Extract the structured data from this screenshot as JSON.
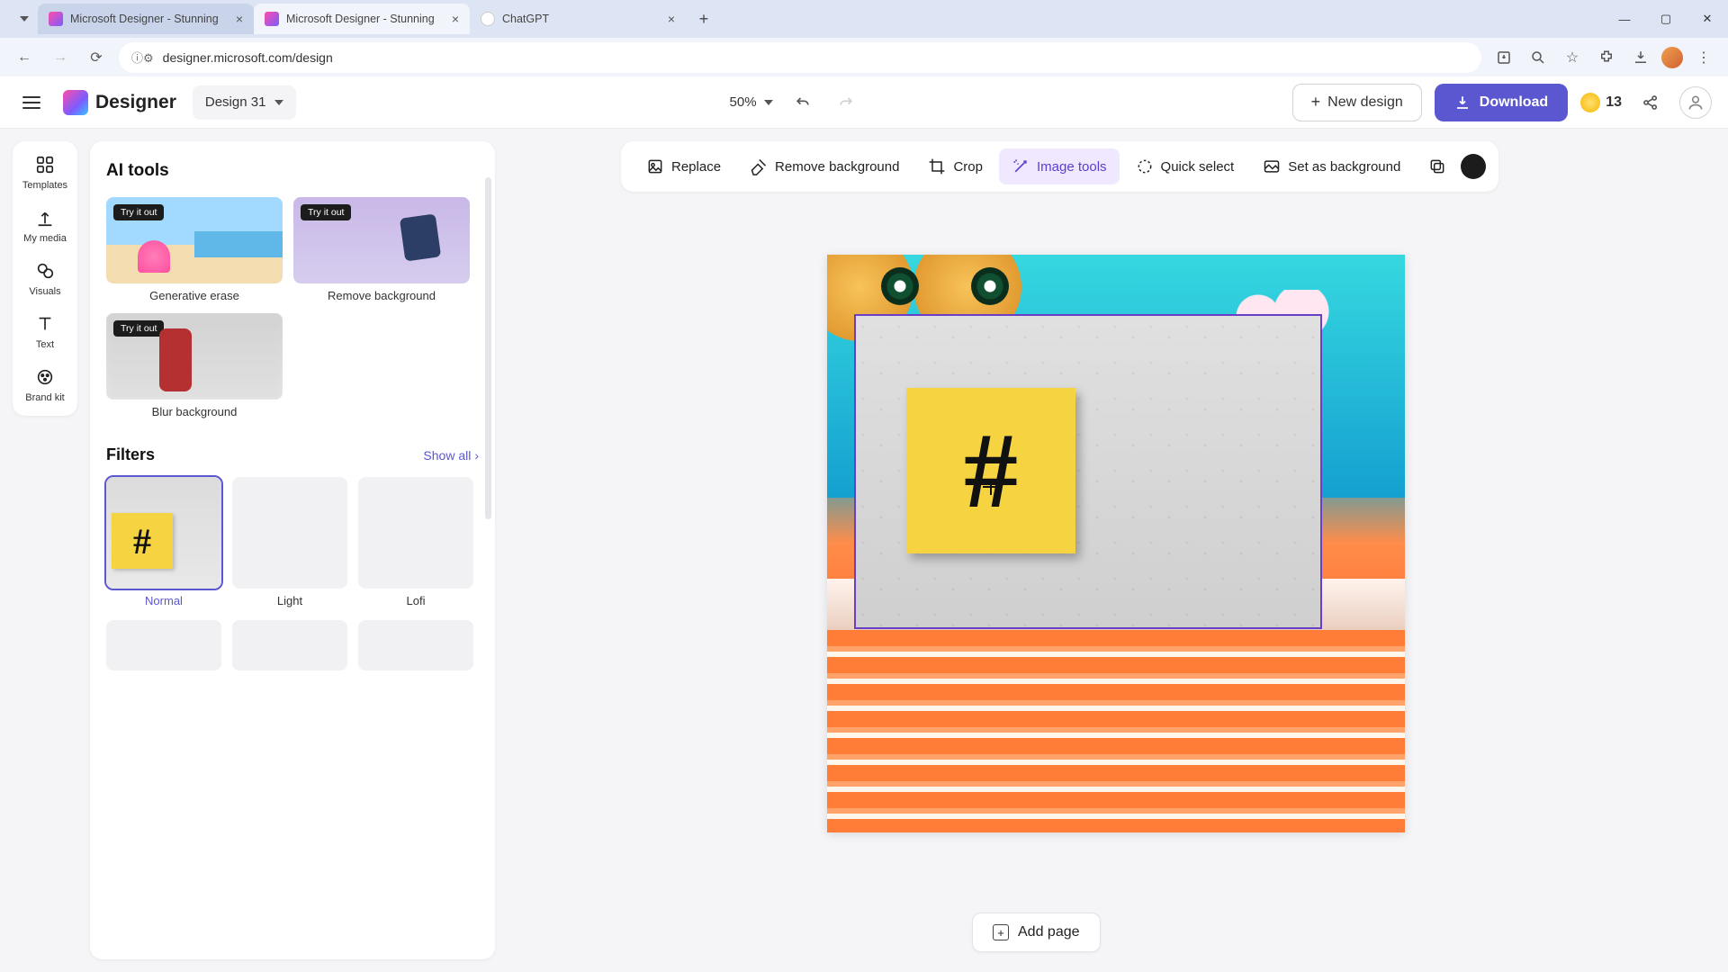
{
  "browser": {
    "tabs": [
      {
        "title": "Microsoft Designer - Stunning",
        "active": false
      },
      {
        "title": "Microsoft Designer - Stunning",
        "active": true
      },
      {
        "title": "ChatGPT",
        "active": false
      }
    ],
    "url": "designer.microsoft.com/design"
  },
  "header": {
    "logo_text": "Designer",
    "design_name": "Design 31",
    "zoom": "50%",
    "new_design": "New design",
    "download": "Download",
    "credits": "13"
  },
  "rail": {
    "items": [
      {
        "label": "Templates"
      },
      {
        "label": "My media"
      },
      {
        "label": "Visuals"
      },
      {
        "label": "Text"
      },
      {
        "label": "Brand kit"
      }
    ]
  },
  "panel": {
    "title": "AI tools",
    "try_badge": "Try it out",
    "tools": [
      {
        "label": "Generative erase"
      },
      {
        "label": "Remove background"
      },
      {
        "label": "Blur background"
      }
    ],
    "filters_title": "Filters",
    "show_all": "Show all",
    "filters": [
      {
        "label": "Normal",
        "selected": true
      },
      {
        "label": "Light",
        "selected": false
      },
      {
        "label": "Lofi",
        "selected": false
      }
    ]
  },
  "toolbar": {
    "replace": "Replace",
    "remove_bg": "Remove background",
    "crop": "Crop",
    "image_tools": "Image tools",
    "quick_select": "Quick select",
    "set_bg": "Set as background"
  },
  "footer": {
    "add_page": "Add page"
  },
  "colors": {
    "accent": "#5b57d1",
    "chip_bg": "#1c1c1c"
  }
}
